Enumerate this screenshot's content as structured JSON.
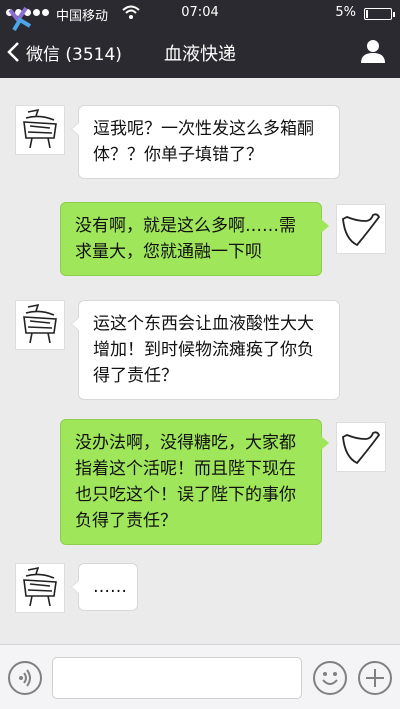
{
  "status_bar": {
    "carrier": "中国移动",
    "time": "07:04",
    "battery_percent": "5%",
    "battery_level": 0.05
  },
  "nav": {
    "back_label": "微信 (3514)",
    "title": "血液快递",
    "icons": {
      "back": "chevron-left-icon",
      "profile": "person-icon"
    }
  },
  "messages": [
    {
      "side": "in",
      "sender": "contact",
      "lines": [
        "逗我呢？一次性发这么多箱酮",
        "体？？你单子填错了？"
      ]
    },
    {
      "side": "out",
      "sender": "me",
      "lines": [
        "没有啊，就是这么多啊……需",
        "求量大，您就通融一下呗"
      ]
    },
    {
      "side": "in",
      "sender": "contact",
      "lines": [
        "运这个东西会让血液酸性大大",
        "增加！到时候物流瘫痪了你负",
        "得了责任？"
      ]
    },
    {
      "side": "out",
      "sender": "me",
      "lines": [
        "没办法啊，没得糖吃，大家都",
        "指着这个活呢！而且陛下现在",
        "也只吃这个！误了陛下的事你",
        "负得了责任？"
      ]
    },
    {
      "side": "in",
      "sender": "contact",
      "lines": [
        "……"
      ]
    }
  ],
  "input_bar": {
    "placeholder": "",
    "icons": {
      "voice": "voice-icon",
      "emoji": "emoji-icon",
      "more": "plus-icon"
    }
  },
  "colors": {
    "bar_bg": "#2b2a30",
    "chat_bg": "#ebebeb",
    "outgoing_bubble": "#9fe65a",
    "incoming_bubble": "#ffffff"
  }
}
